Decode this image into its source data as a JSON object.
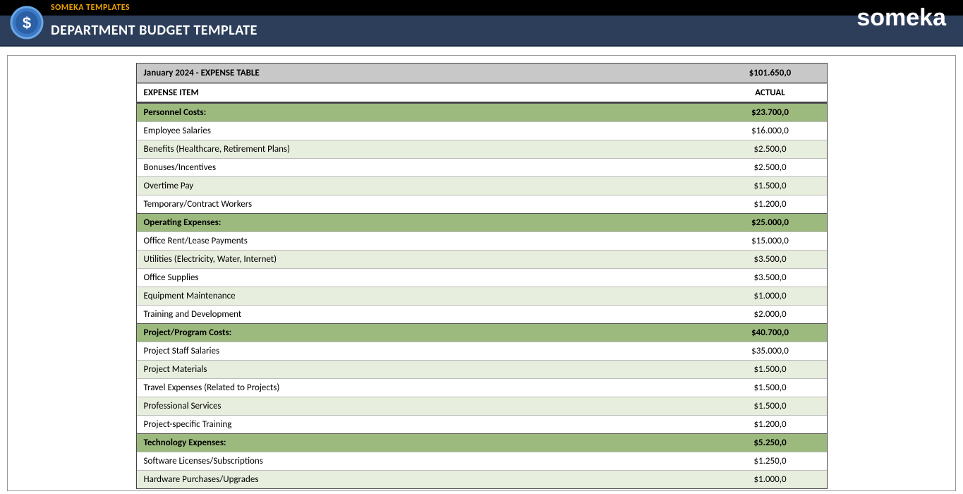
{
  "header": {
    "brand_small": "SOMEKA TEMPLATES",
    "title": "DEPARTMENT BUDGET TEMPLATE",
    "brand_logo": "someka"
  },
  "table": {
    "title": "January 2024 - EXPENSE TABLE",
    "total": "$101.650,0",
    "col_label": "EXPENSE ITEM",
    "col_value": "ACTUAL",
    "groups": [
      {
        "name": "Personnel Costs:",
        "subtotal": "$23.700,0",
        "items": [
          {
            "label": "Employee Salaries",
            "value": "$16.000,0"
          },
          {
            "label": "Benefits (Healthcare, Retirement Plans)",
            "value": "$2.500,0"
          },
          {
            "label": "Bonuses/Incentives",
            "value": "$2.500,0"
          },
          {
            "label": "Overtime Pay",
            "value": "$1.500,0"
          },
          {
            "label": "Temporary/Contract Workers",
            "value": "$1.200,0"
          }
        ]
      },
      {
        "name": "Operating Expenses:",
        "subtotal": "$25.000,0",
        "items": [
          {
            "label": "Office Rent/Lease Payments",
            "value": "$15.000,0"
          },
          {
            "label": "Utilities (Electricity, Water, Internet)",
            "value": "$3.500,0"
          },
          {
            "label": "Office Supplies",
            "value": "$3.500,0"
          },
          {
            "label": "Equipment Maintenance",
            "value": "$1.000,0"
          },
          {
            "label": "Training and Development",
            "value": "$2.000,0"
          }
        ]
      },
      {
        "name": "Project/Program Costs:",
        "subtotal": "$40.700,0",
        "items": [
          {
            "label": "Project Staff Salaries",
            "value": "$35.000,0"
          },
          {
            "label": "Project Materials",
            "value": "$1.500,0"
          },
          {
            "label": "Travel Expenses (Related to Projects)",
            "value": "$1.500,0"
          },
          {
            "label": "Professional Services",
            "value": "$1.500,0"
          },
          {
            "label": "Project-specific Training",
            "value": "$1.200,0"
          }
        ]
      },
      {
        "name": "Technology Expenses:",
        "subtotal": "$5.250,0",
        "items": [
          {
            "label": "Software Licenses/Subscriptions",
            "value": "$1.250,0"
          },
          {
            "label": "Hardware Purchases/Upgrades",
            "value": "$1.000,0"
          }
        ]
      }
    ]
  }
}
